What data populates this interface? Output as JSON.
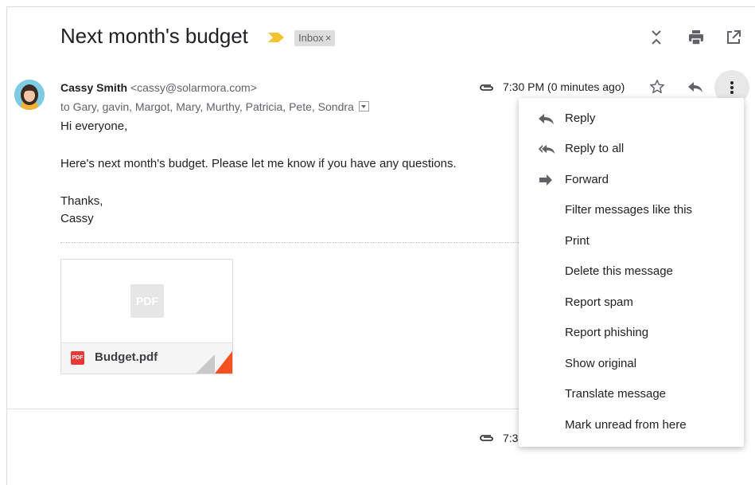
{
  "email": {
    "subject": "Next month's budget",
    "label_chip": "Inbox",
    "label_chip_close": "×",
    "sender_name": "Cassy Smith",
    "sender_email": "<cassy@solarmora.com>",
    "recipients": "to Gary, gavin, Margot, Mary, Murthy, Patricia, Pete, Sondra",
    "time": "7:30 PM (0 minutes ago)",
    "body": {
      "greeting": "Hi everyone,",
      "line1": "Here's next month's budget. Please let me know if you have any questions.",
      "closing": "Thanks,",
      "signature": "Cassy"
    },
    "attachment": {
      "name": "Budget.pdf",
      "preview_label": "PDF",
      "icon_label": "PDF"
    },
    "next_message_time": "7:3"
  },
  "menu": {
    "items": [
      {
        "label": "Reply",
        "icon": "reply-icon"
      },
      {
        "label": "Reply to all",
        "icon": "reply-all-icon"
      },
      {
        "label": "Forward",
        "icon": "forward-icon"
      },
      {
        "label": "Filter messages like this",
        "icon": ""
      },
      {
        "label": "Print",
        "icon": ""
      },
      {
        "label": "Delete this message",
        "icon": ""
      },
      {
        "label": "Report spam",
        "icon": ""
      },
      {
        "label": "Report phishing",
        "icon": ""
      },
      {
        "label": "Show original",
        "icon": ""
      },
      {
        "label": "Translate message",
        "icon": ""
      },
      {
        "label": "Mark unread from here",
        "icon": ""
      }
    ]
  },
  "colors": {
    "importance_marker": "#f4c430",
    "pdf_red": "#e53935",
    "icon_gray": "#5f6368"
  }
}
